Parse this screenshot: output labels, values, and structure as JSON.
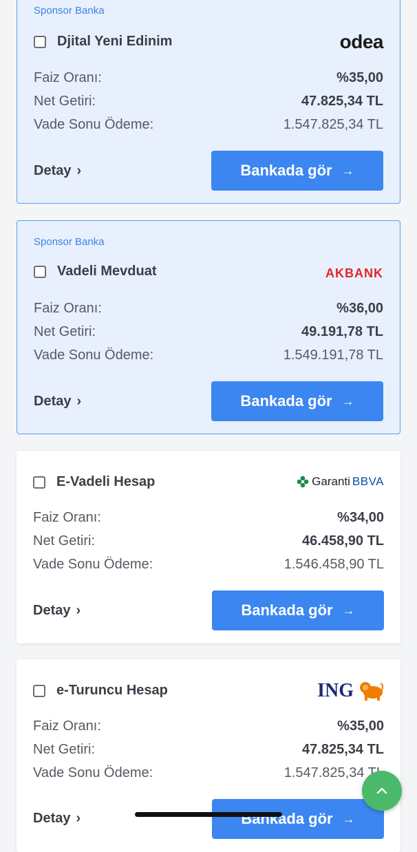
{
  "cards": [
    {
      "sponsor_label": "Sponsor Banka",
      "product": "Djital Yeni Edinim",
      "bank": "odea",
      "labels": {
        "rate": "Faiz Oranı:",
        "net": "Net Getiri:",
        "total": "Vade Sonu Ödeme:"
      },
      "rate": "%35,00",
      "net": "47.825,34 TL",
      "total": "1.547.825,34 TL",
      "detail": "Detay",
      "cta": "Bankada gör"
    },
    {
      "sponsor_label": "Sponsor Banka",
      "product": "Vadeli Mevduat",
      "bank": "AKBANK",
      "labels": {
        "rate": "Faiz Oranı:",
        "net": "Net Getiri:",
        "total": "Vade Sonu Ödeme:"
      },
      "rate": "%36,00",
      "net": "49.191,78 TL",
      "total": "1.549.191,78 TL",
      "detail": "Detay",
      "cta": "Bankada gör"
    },
    {
      "product": "E-Vadeli Hesap",
      "bank": "Garanti BBVA",
      "bank_parts": [
        "Garanti",
        "BBVA"
      ],
      "labels": {
        "rate": "Faiz Oranı:",
        "net": "Net Getiri:",
        "total": "Vade Sonu Ödeme:"
      },
      "rate": "%34,00",
      "net": "46.458,90 TL",
      "total": "1.546.458,90 TL",
      "detail": "Detay",
      "cta": "Bankada gör"
    },
    {
      "product": "e-Turuncu Hesap",
      "bank": "ING",
      "labels": {
        "rate": "Faiz Oranı:",
        "net": "Net Getiri:",
        "total": "Vade Sonu Ödeme:"
      },
      "rate": "%35,00",
      "net": "47.825,34 TL",
      "total": "1.547.825,34 TL",
      "detail": "Detay",
      "cta": "Bankada gör"
    }
  ],
  "colors": {
    "primary": "#3b86f0",
    "sponsor_bg": "#e7f0fc",
    "fab": "#4bb96a",
    "akbank": "#e1252a",
    "ing_orange": "#f07c00",
    "ing_blue": "#1c2a7a",
    "garanti_green": "#1a8a4a"
  },
  "fab_icon": "chevron-up-icon"
}
